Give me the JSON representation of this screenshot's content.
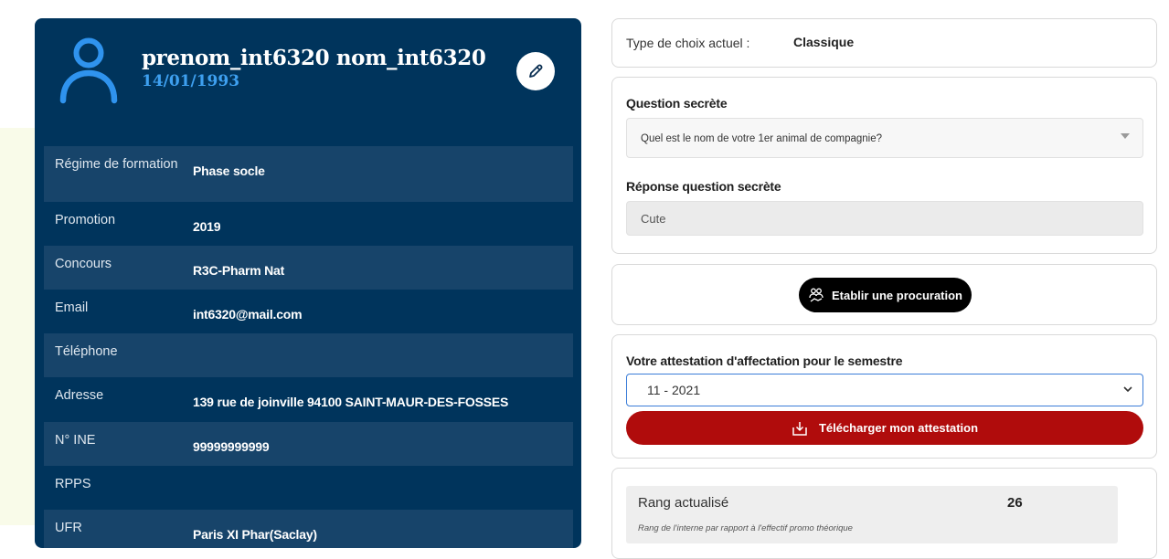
{
  "profile": {
    "name": "prenom_int6320 nom_int6320",
    "birth_date": "14/01/1993",
    "fields": [
      {
        "label": "Régime de formation",
        "value": "Phase socle"
      },
      {
        "label": "Promotion",
        "value": "2019"
      },
      {
        "label": "Concours",
        "value": "R3C-Pharm Nat"
      },
      {
        "label": "Email",
        "value": "int6320@mail.com"
      },
      {
        "label": "Téléphone",
        "value": ""
      },
      {
        "label": "Adresse",
        "value": "139 rue de joinville 94100 SAINT-MAUR-DES-FOSSES"
      },
      {
        "label": "N° INE",
        "value": "99999999999"
      },
      {
        "label": "RPPS",
        "value": ""
      },
      {
        "label": "UFR",
        "value": "Paris XI Phar(Saclay)"
      }
    ]
  },
  "choice": {
    "label": "Type de choix actuel :",
    "value": "Classique"
  },
  "secret": {
    "question_title": "Question secrète",
    "question_value": "Quel est le nom de votre 1er animal de compagnie?",
    "answer_title": "Réponse question secrète",
    "answer_value": "Cute"
  },
  "proxy": {
    "button_label": "Etablir une procuration"
  },
  "attestation": {
    "title": "Votre attestation d'affectation pour le semestre",
    "selected_semester": "11 - 2021",
    "download_label": "Télécharger mon attestation"
  },
  "rank": {
    "label": "Rang actualisé",
    "value": "26",
    "note": "Rang de l'interne par rapport à l'effectif promo théorique"
  },
  "colors": {
    "card_bg": "#00345c",
    "row_alt": "#17446a",
    "accent_blue": "#3ea0f0",
    "download_red": "#b00c0c"
  }
}
